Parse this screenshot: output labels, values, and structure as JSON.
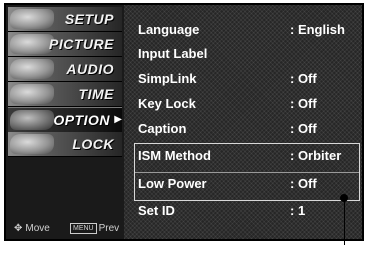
{
  "sidebar": {
    "tabs": [
      {
        "label": "SETUP",
        "icon": "setup-icon"
      },
      {
        "label": "PICTURE",
        "icon": "picture-icon"
      },
      {
        "label": "AUDIO",
        "icon": "audio-icon"
      },
      {
        "label": "TIME",
        "icon": "time-icon"
      },
      {
        "label": "OPTION",
        "icon": "option-icon",
        "active": true
      },
      {
        "label": "LOCK",
        "icon": "lock-icon"
      }
    ],
    "hints": {
      "move": "Move",
      "menu_key": "MENU",
      "prev": "Prev"
    }
  },
  "menu": {
    "items": [
      {
        "label": "Language",
        "value": ": English"
      },
      {
        "label": "Input Label",
        "value": ""
      },
      {
        "label": "SimpLink",
        "value": ": Off"
      },
      {
        "label": "Key Lock",
        "value": ": Off"
      },
      {
        "label": "Caption",
        "value": ": Off"
      },
      {
        "label": "ISM Method",
        "value": ": Orbiter"
      },
      {
        "label": "Low Power",
        "value": ": Off"
      },
      {
        "label": "Set ID",
        "value": ": 1"
      }
    ]
  },
  "colors": {
    "panel": "#262626",
    "text": "#ffffff",
    "frame": "#111111"
  }
}
